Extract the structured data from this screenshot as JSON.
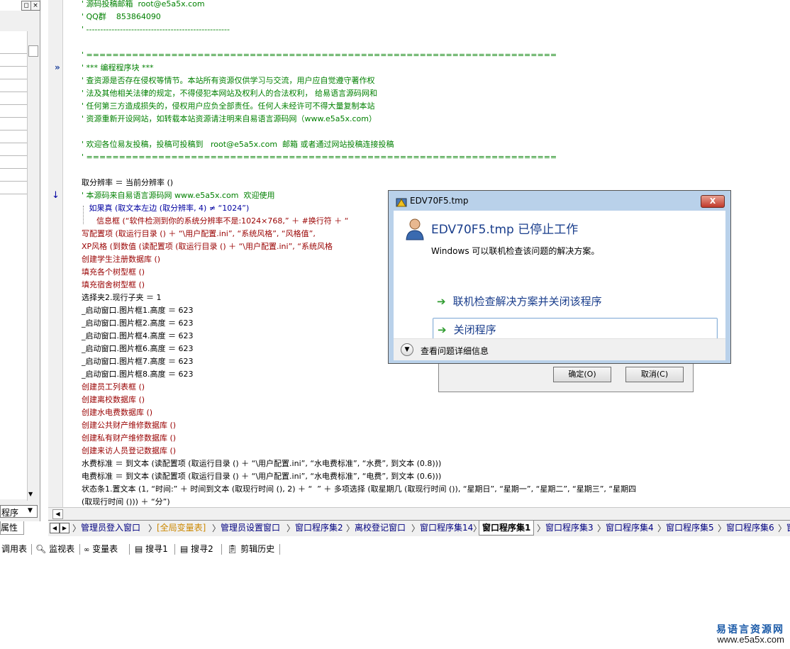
{
  "left_panel": {
    "combo_label": "程序",
    "props_tab": "属性"
  },
  "editor": {
    "lines": [
      {
        "t": "' 源码投稿邮箱  root@e5a5x.com",
        "c": "cm"
      },
      {
        "t": "' QQ群    853864090",
        "c": "cm"
      },
      {
        "t": "' ---------------------------------------------------",
        "c": "cm"
      },
      {
        "t": "",
        "c": "cm"
      },
      {
        "t": "' ========================================================================",
        "c": "cm"
      },
      {
        "t": "' *** 编程程序块 ***",
        "c": "cm"
      },
      {
        "t": "' 查资源是否存在侵权等情节。本站所有资源仅供学习与交流，用户应自觉遵守著作权",
        "c": "cm"
      },
      {
        "t": "' 法及其他相关法律的规定，不得侵犯本网站及权利人的合法权利， 给易语言源码网和",
        "c": "cm"
      },
      {
        "t": "' 任何第三方造成损失的，侵权用户应负全部责任。任何人未经许可不得大量复制本站",
        "c": "cm"
      },
      {
        "t": "' 资源重新开设网站，如转载本站资源请注明来自易语言源码网（www.e5a5x.com）",
        "c": "cm"
      },
      {
        "t": "",
        "c": "cm"
      },
      {
        "t": "' 欢迎各位易友投稿，投稿可投稿到   root@e5a5x.com  邮箱 或者通过网站投稿连接投稿",
        "c": "cm"
      },
      {
        "t": "' ========================================================================",
        "c": "cm"
      },
      {
        "t": "",
        "c": "cm"
      },
      {
        "t": "取分辨率 ＝ 当前分辨率 ()",
        "c": "bk"
      },
      {
        "t": "' 本源码来自易语言源码网 www.e5a5x.com  欢迎使用",
        "c": "cm"
      },
      {
        "t": "   如果真 (取文本左边 (取分辨率, 4) ≠ “1024”)",
        "c": "bl"
      },
      {
        "t": "      信息框 (“软件检测到你的系统分辨率不是:1024×768,” ＋ #换行符 ＋ “",
        "c": "rd"
      },
      {
        "t": "写配置项 (取运行目录 () ＋ “\\用户配置.ini”, “系统风格”, “风格值”,",
        "c": "rd"
      },
      {
        "t": "XP风格 (到数值 (读配置项 (取运行目录 () ＋ “\\用户配置.ini”, “系统风格",
        "c": "rd"
      },
      {
        "t": "创建学生注册数据库 ()",
        "c": "rd"
      },
      {
        "t": "填充各个树型框 ()",
        "c": "rd"
      },
      {
        "t": "填充宿舍树型框 ()",
        "c": "rd"
      },
      {
        "t": "选择夹2.现行子夹 ＝ 1",
        "c": "bk"
      },
      {
        "t": "_启动窗口.图片框1.高度 ＝ 623",
        "c": "bk"
      },
      {
        "t": "_启动窗口.图片框2.高度 ＝ 623",
        "c": "bk"
      },
      {
        "t": "_启动窗口.图片框4.高度 ＝ 623",
        "c": "bk"
      },
      {
        "t": "_启动窗口.图片框6.高度 ＝ 623",
        "c": "bk"
      },
      {
        "t": "_启动窗口.图片框7.高度 ＝ 623",
        "c": "bk"
      },
      {
        "t": "_启动窗口.图片框8.高度 ＝ 623",
        "c": "bk"
      },
      {
        "t": "创建员工列表框 ()",
        "c": "rd"
      },
      {
        "t": "创建离校数据库 ()",
        "c": "rd"
      },
      {
        "t": "创建水电费数据库 ()",
        "c": "rd"
      },
      {
        "t": "创建公共财产维修数据库 ()",
        "c": "rd"
      },
      {
        "t": "创建私有财产维修数据库 ()",
        "c": "rd"
      },
      {
        "t": "创建来访人员登记数据库 ()",
        "c": "rd"
      },
      {
        "t": "水费标准 ＝ 到文本 (读配置项 (取运行目录 () ＋ “\\用户配置.ini”, “水电费标准”, “水费”, 到文本 (0.8)))",
        "c": "bk"
      },
      {
        "t": "电费标准 ＝ 到文本 (读配置项 (取运行目录 () ＋ “\\用户配置.ini”, “水电费标准”, “电费”, 到文本 (0.6)))",
        "c": "bk"
      },
      {
        "t": "状态条1.置文本 (1, “时间:” ＋ 时间到文本 (取现行时间 (), 2) ＋ “  ” ＋ 多项选择 (取星期几 (取现行时间 ()), “星期日”, “星期一”, “星期二”, “星期三”, “星期四",
        "c": "bk"
      },
      {
        "t": "(取现行时间 ())) ＋ “分”)",
        "c": "bk"
      }
    ]
  },
  "tabs": [
    {
      "label": "管理员登入窗口",
      "kind": "normal"
    },
    {
      "label": "[全局变量表]",
      "kind": "global"
    },
    {
      "label": "管理员设置窗口",
      "kind": "normal"
    },
    {
      "label": "窗口程序集2",
      "kind": "normal"
    },
    {
      "label": "离校登记窗口",
      "kind": "normal"
    },
    {
      "label": "窗口程序集14",
      "kind": "normal"
    },
    {
      "label": "窗口程序集1",
      "kind": "selected"
    },
    {
      "label": "窗口程序集3",
      "kind": "normal"
    },
    {
      "label": "窗口程序集4",
      "kind": "normal"
    },
    {
      "label": "窗口程序集5",
      "kind": "normal"
    },
    {
      "label": "窗口程序集6",
      "kind": "normal"
    },
    {
      "label": "窗",
      "kind": "normal"
    }
  ],
  "bottom_toolbar": {
    "call_table": "调用表",
    "watch_table": "监视表",
    "var_table": "变量表",
    "search1": "搜寻1",
    "search2": "搜寻2",
    "clip_history": "剪辑历史"
  },
  "back_dialog": {
    "ok": "确定(O)",
    "cancel": "取消(C)"
  },
  "error_dialog": {
    "title": "EDV70F5.tmp",
    "heading": "EDV70F5.tmp 已停止工作",
    "message": "Windows 可以联机检查该问题的解决方案。",
    "option1": "联机检查解决方案并关闭该程序",
    "option2": "关闭程序",
    "details": "查看问题详细信息",
    "close_glyph": "X"
  },
  "watermark": {
    "cn": "易语言资源网",
    "url": "www.e5a5x.com"
  },
  "colors": {
    "comment": "#008000",
    "command": "#990000",
    "flow": "#0000a0",
    "link": "#1a3e8c"
  }
}
